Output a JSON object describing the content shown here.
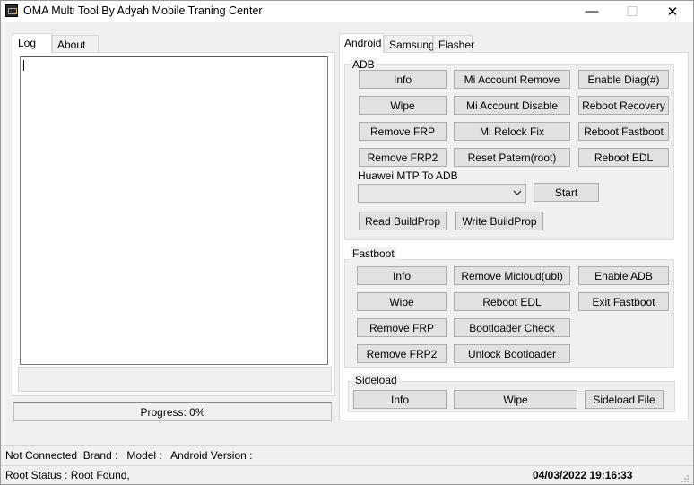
{
  "window": {
    "title": "OMA Multi Tool By Adyah Mobile Traning Center",
    "controls": {
      "minimize": "—",
      "maximize": "☐",
      "close": "✕"
    }
  },
  "left_tabs": [
    "Log",
    "About"
  ],
  "progress_text": "Progress: 0%",
  "right_tabs": [
    "Android",
    "Samsung",
    "Flasher"
  ],
  "adb": {
    "label": "ADB",
    "buttons": [
      "Info",
      "Mi Account Remove",
      "Enable Diag(#)",
      "Wipe",
      "Mi Account Disable",
      "Reboot Recovery",
      "Remove FRP",
      "Mi Relock Fix",
      "Reboot Fastboot",
      "Remove FRP2",
      "Reset Patern(root)",
      "Reboot EDL"
    ],
    "huawei_label": "Huawei MTP To ADB",
    "combo_value": "",
    "start": "Start",
    "read_buildprop": "Read BuildProp",
    "write_buildprop": "Write BuildProp"
  },
  "fastboot": {
    "label": "Fastboot",
    "buttons": [
      "Info",
      "Remove Micloud(ubl)",
      "Enable ADB",
      "Wipe",
      "Reboot EDL",
      "Exit Fastboot",
      "Remove FRP",
      "Bootloader Check",
      "Remove FRP2",
      "Unlock Bootloader"
    ]
  },
  "sideload": {
    "label": "Sideload",
    "buttons": [
      "Info",
      "Wipe",
      "Sideload File"
    ]
  },
  "status": {
    "line1": "Not Connected  Brand :   Model :   Android Version :",
    "line2": "Root Status : Root Found,",
    "datetime": "04/03/2022 19:16:33"
  }
}
